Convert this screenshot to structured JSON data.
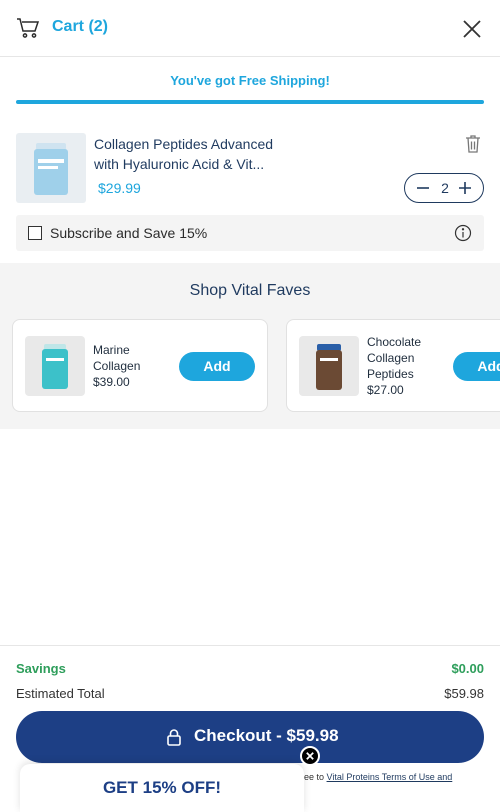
{
  "header": {
    "cart_title": "Cart (2)"
  },
  "shipping": {
    "message": "You've got Free Shipping!",
    "progress": 1.0
  },
  "cart_item": {
    "name_line1": "Collagen Peptides Advanced",
    "name_line2": "with Hyaluronic Acid & Vit...",
    "price": "$29.99",
    "quantity": "2"
  },
  "subscribe": {
    "label": "Subscribe and Save 15%"
  },
  "faves": {
    "title": "Shop Vital Faves",
    "items": [
      {
        "name_lines": [
          "Marine",
          "Collagen"
        ],
        "price": "$39.00",
        "add_label": "Add"
      },
      {
        "name_lines": [
          "Chocolate",
          "Collagen",
          "Peptides"
        ],
        "price": "$27.00",
        "add_label": "Add"
      }
    ]
  },
  "summary": {
    "savings_label": "Savings",
    "savings_value": "$0.00",
    "total_label": "Estimated Total",
    "total_value": "$59.98"
  },
  "checkout": {
    "label": "Checkout - $59.98"
  },
  "terms": {
    "prefix": "gree to",
    "link": "Vital Proteins Terms of Use and"
  },
  "promo": {
    "label": "GET 15% OFF!"
  },
  "colors": {
    "accent": "#1ea6dd",
    "brand_navy": "#1d3f85",
    "savings_green": "#2e9e5b"
  },
  "icons": [
    "cart-icon",
    "close-icon",
    "trash-icon",
    "minus-icon",
    "plus-icon",
    "info-icon",
    "lock-icon"
  ]
}
